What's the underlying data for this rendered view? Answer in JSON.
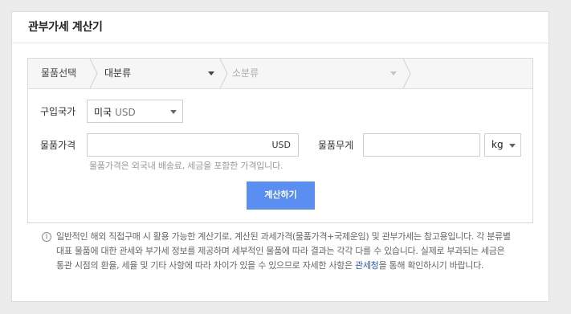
{
  "title": "관부가세 계산기",
  "category": {
    "label": "물품선택",
    "main_value": "대분류",
    "sub_value": "소분류"
  },
  "country": {
    "label": "구입국가",
    "value": "미국",
    "currency": "USD"
  },
  "price": {
    "label": "물품가격",
    "value": "",
    "unit": "USD",
    "hint": "물품가격은 외국내 배송료, 세금을 포함한 가격입니다."
  },
  "weight": {
    "label": "물품무게",
    "value": "",
    "unit_value": "kg"
  },
  "calculate_label": "계산하기",
  "notice": {
    "icon": "info-icon",
    "text_before": "일반적인 해외 직접구매 시 활용 가능한 계산기로, 계산된 과세가격(물품가격+국제운임) 및 관부가세는 참고용입니다. 각 분류별 대표 물품에 대한 관세와 부가세 정보를 제공하며 세부적인 물품에 따라 결과는 각각 다를 수 있습니다. 실제로 부과되는 세금은 통관 시점의 환율, 세율 및 기타 사항에 따라 차이가 있을 수 있으므로 자세한 사항은 ",
    "link": "관세청",
    "text_after": "을 통해 확인하시기 바랍니다."
  },
  "colors": {
    "button": "#5b8ef1",
    "link": "#2a5bb8"
  }
}
